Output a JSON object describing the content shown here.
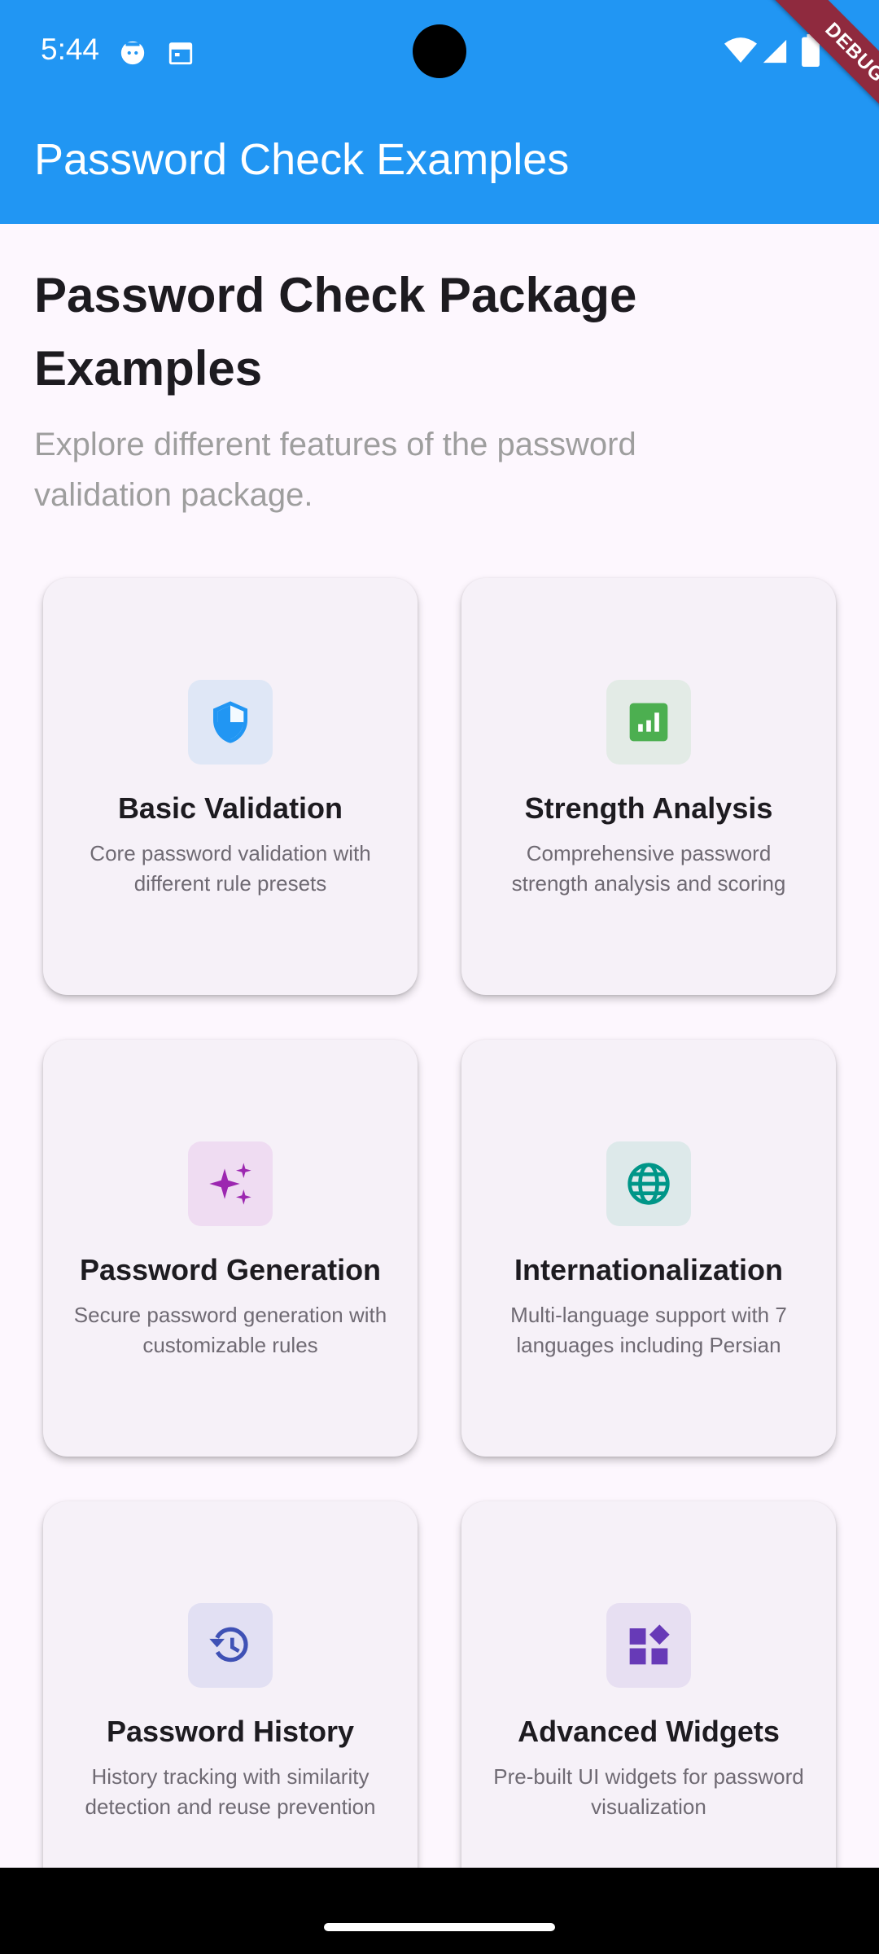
{
  "status_bar": {
    "time": "5:44",
    "icons": [
      "android-debug-icon",
      "calendar-icon",
      "wifi-icon",
      "signal-icon",
      "battery-icon"
    ]
  },
  "app_bar": {
    "title": "Password Check Examples",
    "color": "#2196f3",
    "debug_label": "DEBUG"
  },
  "header": {
    "title": "Password Check Package Examples",
    "subtitle": "Explore different features of the password validation package."
  },
  "cards": [
    {
      "title": "Basic Validation",
      "description": "Core password validation with different rule presets",
      "icon": "shield-icon",
      "accent": "#2196f3",
      "tint": "#dfe7f6"
    },
    {
      "title": "Strength Analysis",
      "description": "Comprehensive password strength analysis and scoring",
      "icon": "analytics-icon",
      "accent": "#4caf50",
      "tint": "#e3ebe6"
    },
    {
      "title": "Password Generation",
      "description": "Secure password generation with customizable rules",
      "icon": "sparkle-icon",
      "accent": "#9c27b0",
      "tint": "#efdcf2"
    },
    {
      "title": "Internationalization",
      "description": "Multi-language support with 7 languages including Persian",
      "icon": "globe-icon",
      "accent": "#009688",
      "tint": "#dde9ea"
    },
    {
      "title": "Password History",
      "description": "History tracking with similarity detection and reuse prevention",
      "icon": "history-icon",
      "accent": "#3f51b5",
      "tint": "#e2e0f3"
    },
    {
      "title": "Advanced Widgets",
      "description": "Pre-built UI widgets for password visualization",
      "icon": "widgets-icon",
      "accent": "#673ab7",
      "tint": "#e7dff2"
    }
  ]
}
